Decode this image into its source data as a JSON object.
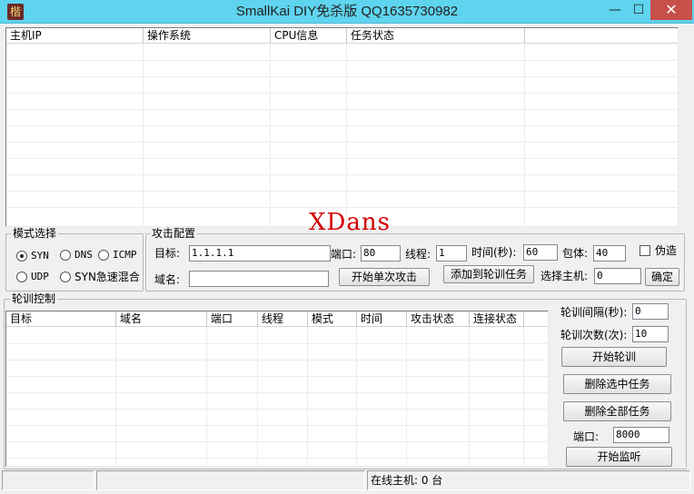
{
  "window": {
    "icon_glyph": "楷",
    "title": "SmallKai DIY免杀版 QQ1635730982",
    "min": "—",
    "max": "☐",
    "close": "✕"
  },
  "hosts_table": {
    "columns": [
      "主机IP",
      "操作系统",
      "CPU信息",
      "任务状态",
      ""
    ]
  },
  "watermark": "XDans",
  "mode_group": {
    "title": "模式选择",
    "options": [
      {
        "label": "SYN",
        "selected": true
      },
      {
        "label": "DNS",
        "selected": false
      },
      {
        "label": "ICMP",
        "selected": false
      },
      {
        "label": "UDP",
        "selected": false
      },
      {
        "label": "SYN急速混合",
        "selected": false
      }
    ]
  },
  "attack_config": {
    "title": "攻击配置",
    "target_label": "目标:",
    "target_value": "1.1.1.1",
    "port_label": "端口:",
    "port_value": "80",
    "threads_label": "线程:",
    "threads_value": "1",
    "time_label": "时间(秒):",
    "time_value": "60",
    "packet_label": "包体:",
    "packet_value": "40",
    "spoof_label": "伪造",
    "spoof_checked": false,
    "domain_label": "域名:",
    "domain_value": "",
    "single_attack_button": "开始单次攻击",
    "add_task_button": "添加到轮训任务",
    "select_host_label": "选择主机:",
    "select_host_value": "0",
    "confirm_button": "确定"
  },
  "rotation": {
    "title": "轮训控制",
    "columns": [
      "目标",
      "域名",
      "端口",
      "线程",
      "模式",
      "时间",
      "攻击状态",
      "连接状态"
    ],
    "interval_label": "轮训间隔(秒):",
    "interval_value": "0",
    "count_label": "轮训次数(次):",
    "count_value": "10",
    "start_button": "开始轮训",
    "delete_selected_button": "删除选中任务",
    "delete_all_button": "删除全部任务",
    "port_label": "端口:",
    "port_value": "8000",
    "listen_button": "开始监听"
  },
  "statusbar": {
    "cell1": "",
    "cell2": "",
    "online_hosts": "在线主机: 0 台"
  }
}
